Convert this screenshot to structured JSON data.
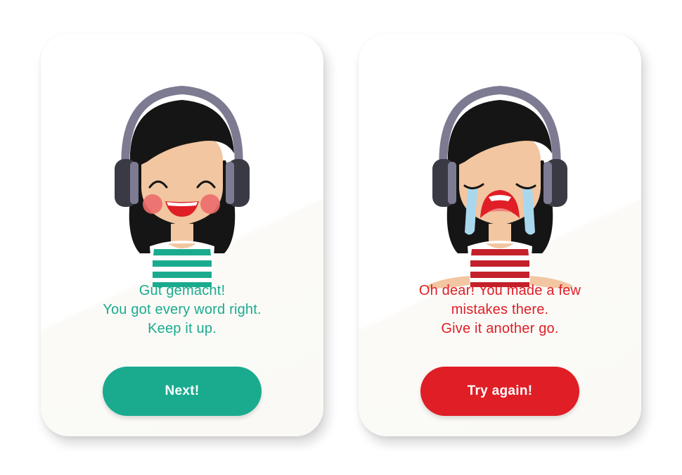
{
  "success_card": {
    "message_lines": [
      "Gut gemacht!",
      "You got every word right.",
      "Keep it up."
    ],
    "button_label": "Next!",
    "accent_color": "#1aab8f",
    "avatar": "happy-girl-with-headphones",
    "shirt_color": "#1aab8f"
  },
  "fail_card": {
    "message_lines": [
      "Oh dear! You made a few",
      "mistakes there.",
      "Give it another go."
    ],
    "button_label": "Try again!",
    "accent_color": "#e01e26",
    "avatar": "crying-girl-with-headphones",
    "shirt_color": "#c4202a"
  }
}
